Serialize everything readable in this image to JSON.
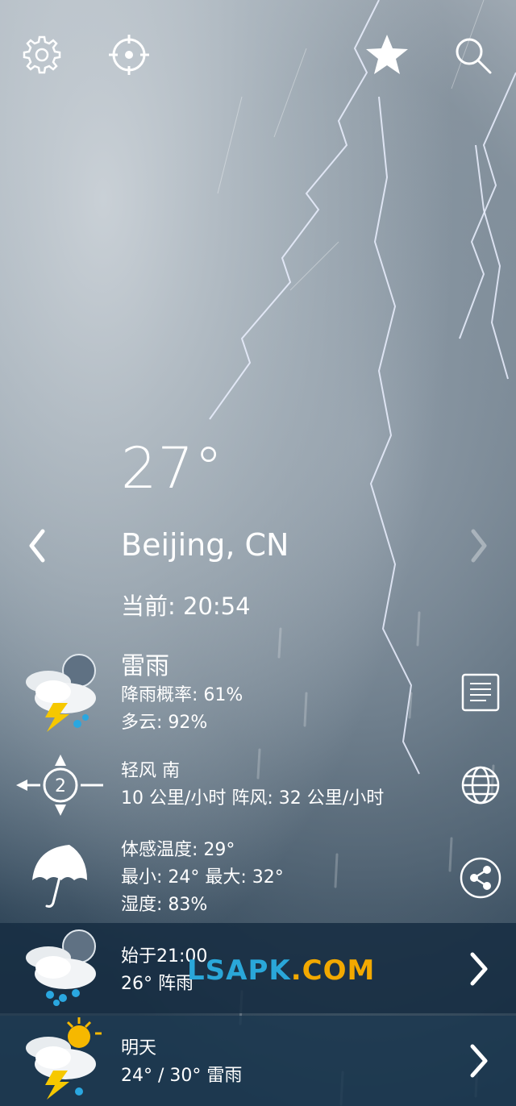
{
  "header": {
    "icons": [
      "gear-icon",
      "location-target-icon",
      "star-icon",
      "search-icon"
    ]
  },
  "current": {
    "temperature": "27°",
    "city": "Beijing, CN",
    "time": "当前: 20:54"
  },
  "details": {
    "condition": "雷雨",
    "precip": "降雨概率: 61%",
    "cloud": "多云: 92%",
    "wind_title": "轻风 南",
    "wind_detail": "10 公里/小时 阵风: 32 公里/小时",
    "wind_beaufort": "2",
    "feels_like": "体感温度: 29°",
    "min_max": "最小: 24° 最大: 32°",
    "humidity": "湿度: 83%"
  },
  "forecast": [
    {
      "title": "始于21:00",
      "summary": "26° 阵雨"
    },
    {
      "title": "明天",
      "summary": "24° / 30° 雷雨"
    }
  ],
  "watermark": {
    "part1": "LSAPK",
    "part2": ".COM"
  }
}
